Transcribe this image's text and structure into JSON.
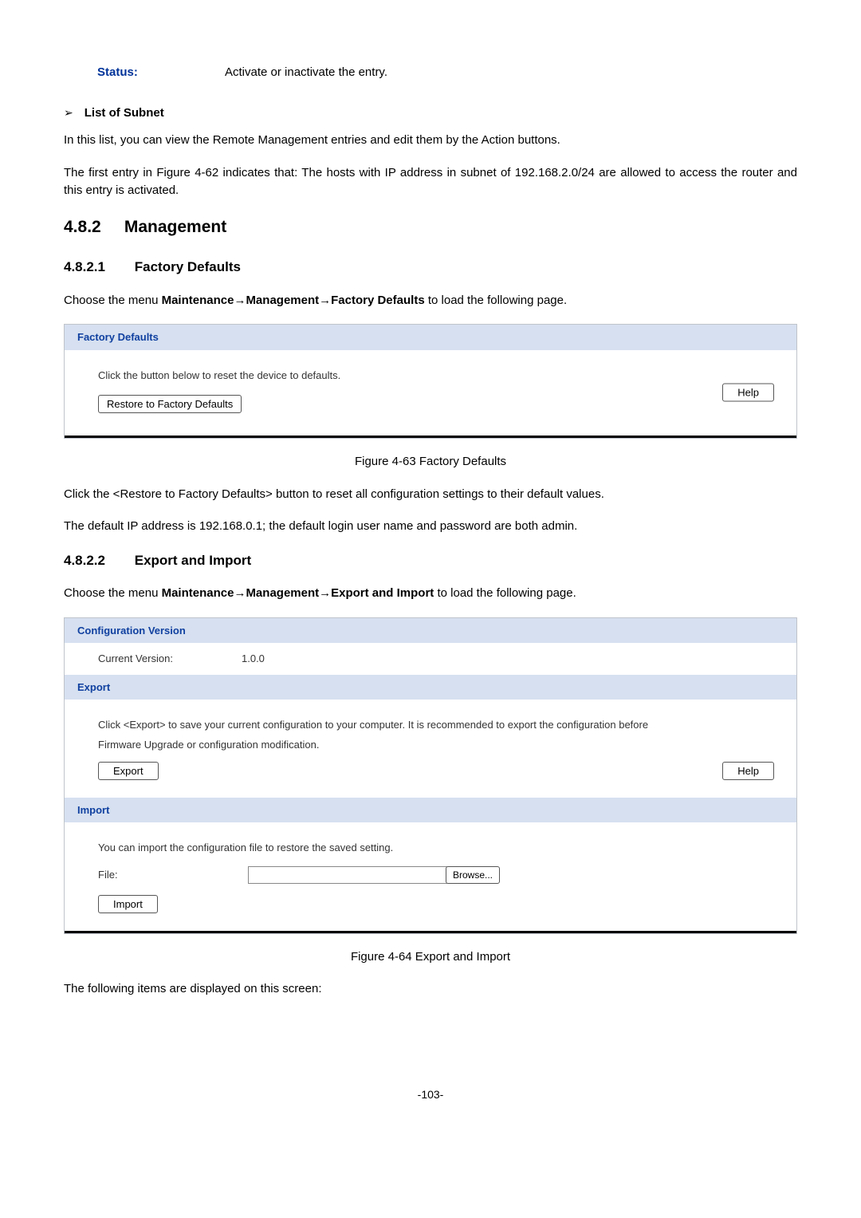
{
  "status": {
    "label": "Status:",
    "desc": "Activate or inactivate the entry."
  },
  "list_subnet": {
    "heading": "List of Subnet",
    "p1": "In this list, you can view the Remote Management entries and edit them by the Action buttons.",
    "p2": "The first entry in Figure 4-62 indicates that: The hosts with IP address in subnet of 192.168.2.0/24 are allowed to access the router and this entry is activated."
  },
  "sec482": {
    "num": "4.8.2",
    "title": "Management"
  },
  "sec4821": {
    "num": "4.8.2.1",
    "title": "Factory Defaults",
    "choose_pre": "Choose the menu ",
    "choose_b1": "Maintenance",
    "choose_b2": "Management",
    "choose_b3": "Factory Defaults",
    "choose_post": " to load the following page.",
    "panel_header": "Factory Defaults",
    "panel_text": "Click the button below to reset the device to defaults.",
    "restore_btn": "Restore to Factory Defaults",
    "help": "Help",
    "caption": "Figure 4-63 Factory Defaults",
    "after1": "Click the <Restore to Factory Defaults> button to reset all configuration settings to their default values.",
    "after2": "The default IP address is 192.168.0.1; the default login user name and password are both admin."
  },
  "sec4822": {
    "num": "4.8.2.2",
    "title": "Export and Import",
    "choose_pre": "Choose the menu ",
    "choose_b1": "Maintenance",
    "choose_b2": "Management",
    "choose_b3": "Export and Import",
    "choose_post": " to load the following page.",
    "panel1_header": "Configuration Version",
    "cv_label": "Current Version:",
    "cv_value": "1.0.0",
    "panel2_header": "Export",
    "export_text": "Click <Export> to save your current configuration to your computer. It is recommended to export the configuration before Firmware Upgrade or configuration modification.",
    "export_btn": "Export",
    "help": "Help",
    "panel3_header": "Import",
    "import_text": "You can import the configuration file to restore the saved setting.",
    "file_label": "File:",
    "browse_btn": "Browse...",
    "import_btn": "Import",
    "caption": "Figure 4-64 Export and Import",
    "after": "The following items are displayed on this screen:"
  },
  "page_num": "-103-"
}
